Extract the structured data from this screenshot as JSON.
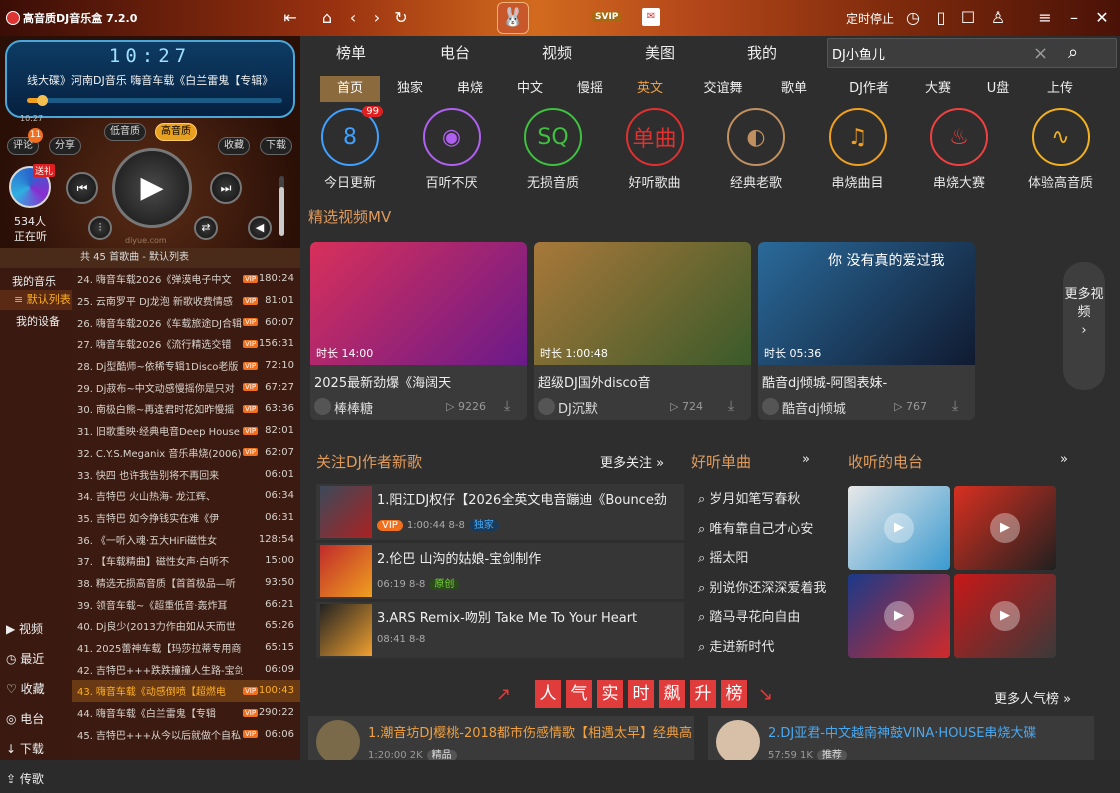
{
  "app": {
    "title": "高音质DJ音乐盒 7.2.0",
    "timer_label": "定时停止",
    "svip": "SVIP"
  },
  "player": {
    "clock": "10:27",
    "scroll_text": "线大碟》河南DJ音乐   嗨音车载《白兰雷鬼【专辑》",
    "elapsed": "10:27",
    "progress": 0.06,
    "volume": 0.82,
    "btn_low": "低音质",
    "btn_high": "高音质",
    "btn_comment": "评论",
    "btn_share": "分享",
    "btn_fav": "收藏",
    "btn_download": "下载",
    "comment_count": "11",
    "gift_tag": "送礼",
    "listeners": "534人",
    "listening": "正在听",
    "watermark": "diyue.com"
  },
  "playlist": {
    "header": "共 45 首歌曲 - 默认列表"
  },
  "nav": {
    "my_music": "我的音乐",
    "default_list": "默认列表",
    "my_device": "我的设备"
  },
  "side": [
    {
      "label": "视频",
      "icon": "video-icon",
      "glyph": "▶"
    },
    {
      "label": "最近",
      "icon": "clock-icon",
      "glyph": "◷"
    },
    {
      "label": "收藏",
      "icon": "heart-icon",
      "glyph": "♡"
    },
    {
      "label": "电台",
      "icon": "radio-icon",
      "glyph": "◎"
    },
    {
      "label": "下载",
      "icon": "download-icon",
      "glyph": "↓"
    },
    {
      "label": "传歌",
      "icon": "upload-icon",
      "glyph": "⇪"
    }
  ],
  "songs": [
    {
      "n": "24.",
      "t": "嗨音车载2026《弹漠电子中文",
      "vip": "VIP",
      "d": "180:24"
    },
    {
      "n": "25.",
      "t": "云南罗平 DJ龙泡 新歌收费情感",
      "vip": "VIP",
      "d": "81:01"
    },
    {
      "n": "26.",
      "t": "嗨音车载2026《车载旅途DJ合辑",
      "vip": "VIP",
      "d": "60:07"
    },
    {
      "n": "27.",
      "t": "嗨音车载2026《流行精选交错",
      "vip": "VIP",
      "d": "156:31"
    },
    {
      "n": "28.",
      "t": "Dj型酷师~依稀专辑1Disco老版",
      "vip": "VIP",
      "d": "72:10"
    },
    {
      "n": "29.",
      "t": "Dj菽布~中文动感慢摇你是只对",
      "vip": "VIP",
      "d": "67:27"
    },
    {
      "n": "30.",
      "t": "南极白熊~再逢君时花如昨慢摇",
      "vip": "VIP",
      "d": "63:36"
    },
    {
      "n": "31.",
      "t": "旧歌重映·经典电音Deep House",
      "vip": "VIP",
      "d": "82:01"
    },
    {
      "n": "32.",
      "t": "C.Y.S.Meganix 音乐串烧(2006)",
      "vip": "VIP",
      "d": "62:07"
    },
    {
      "n": "33.",
      "t": "快四    也许我告别将不再回来",
      "vip": "",
      "d": "06:01"
    },
    {
      "n": "34.",
      "t": "吉特巴    火山热海- 龙江辉、",
      "vip": "",
      "d": "06:34"
    },
    {
      "n": "35.",
      "t": "吉特巴    如今挣钱实在难《伊",
      "vip": "",
      "d": "06:31"
    },
    {
      "n": "36.",
      "t": "《一听入魂·五大HiFi磁性女",
      "vip": "",
      "d": "128:54"
    },
    {
      "n": "37.",
      "t": "【车载精曲】磁性女声·白听不",
      "vip": "",
      "d": "15:00"
    },
    {
      "n": "38.",
      "t": "精选无损高音质【首首极品—听",
      "vip": "",
      "d": "93:50"
    },
    {
      "n": "39.",
      "t": "领音车载~《超重低音·轰炸耳",
      "vip": "",
      "d": "66:21"
    },
    {
      "n": "40.",
      "t": "Dj良少(2013力作由如从天而世",
      "vip": "",
      "d": "65:26"
    },
    {
      "n": "41.",
      "t": "2025蕾神车载【玛莎拉蒂专用商",
      "vip": "",
      "d": "65:15"
    },
    {
      "n": "42.",
      "t": "吉特巴+++跌跌撞撞人生路-宝剑",
      "vip": "",
      "d": "06:09"
    },
    {
      "n": "43.",
      "t": "嗨音车载《动感倒喷【超燃电",
      "vip": "VIP",
      "d": "100:43"
    },
    {
      "n": "44.",
      "t": "嗨音车载《白兰雷鬼【专辑",
      "vip": "VIP",
      "d": "290:22"
    },
    {
      "n": "45.",
      "t": "吉特巴+++从今以后就做个自私",
      "vip": "VIP",
      "d": "06:06"
    }
  ],
  "main": {
    "tabs1": [
      "榜单",
      "电台",
      "视频",
      "美图",
      "我的"
    ],
    "search": {
      "value": "DJ小鱼儿",
      "clear": "×"
    },
    "tabs2": [
      "首页",
      "独家",
      "串烧",
      "中文",
      "慢摇",
      "英文",
      "交谊舞",
      "歌单",
      "DJ作者",
      "大赛",
      "U盘",
      "上传"
    ],
    "categories": [
      {
        "label": "今日更新",
        "glyph": "8",
        "badge": "99",
        "color": "#3fa0ff",
        "icon": "calendar-icon"
      },
      {
        "label": "百听不厌",
        "glyph": "◉",
        "color": "#b060f0",
        "icon": "disc-icon"
      },
      {
        "label": "无损音质",
        "glyph": "SQ",
        "color": "#40c040",
        "icon": "headphones-icon"
      },
      {
        "label": "好听歌曲",
        "glyph": "单曲",
        "color": "#e03030",
        "icon": "single-icon"
      },
      {
        "label": "经典老歌",
        "glyph": "◐",
        "color": "#c09060",
        "icon": "gramophone-icon"
      },
      {
        "label": "串烧曲目",
        "glyph": "♫",
        "color": "#f0a020",
        "icon": "list-music-icon"
      },
      {
        "label": "串烧大赛",
        "glyph": "♨",
        "color": "#f04040",
        "icon": "flame-icon"
      },
      {
        "label": "体验高音质",
        "glyph": "∿",
        "color": "#f0b020",
        "icon": "waveform-icon"
      }
    ],
    "mv_title": "精选视频MV",
    "mv": [
      {
        "title": "2025最新劲爆《海阔天",
        "duration": "时长 14:00",
        "author": "棒棒糖",
        "count": "9226",
        "c1": "#d8305a",
        "c2": "#6a1a8a"
      },
      {
        "title": "超级DJ国外disco音",
        "duration": "时长 1:00:48",
        "author": "DJ沉默",
        "count": "724",
        "c1": "#a8783a",
        "c2": "#3a5a2a"
      },
      {
        "title": "酷音dj倾城-阿图表妹-",
        "duration": "时长 05:36",
        "author": "酷音dj倾城",
        "count": "767",
        "c1": "#2a6a9a",
        "c2": "#101a30",
        "overlay": "你  没有真的爱过我"
      }
    ],
    "more_mv": "更多视频",
    "dj_title": "关注DJ作者新歌",
    "dj_more": "更多关注",
    "dj": [
      {
        "title": "1.阳江DJ权仔【2026全英文电音蹦迪《Bounce劲",
        "meta": "1:00:44  8-8",
        "tag1": "VIP",
        "tag2": "独家",
        "c1": "#3a4a5a",
        "c2": "#aa2222"
      },
      {
        "title": "2.伦巴 山沟的姑娘-宝剑制作",
        "meta": "06:19  8-8",
        "tag1": "",
        "tag2": "原创",
        "c1": "#c02a2a",
        "c2": "#f0a020"
      },
      {
        "title": "3.ARS Remix-吻別 Take Me To Your Heart",
        "meta": "08:41  8-8",
        "tag1": "",
        "tag2": "",
        "c1": "#222222",
        "c2": "#f0a030"
      }
    ],
    "hot_title": "好听单曲",
    "hot": [
      "岁月如笔写春秋",
      "唯有靠自己才心安",
      "摇太阳",
      "别说你还深深爱着我",
      "踏马寻花向自由",
      "走进新时代"
    ],
    "radio_title": "收听的电台",
    "popular_title": [
      "人",
      "气",
      "实",
      "时",
      "飙",
      "升",
      "榜"
    ],
    "popular_more": "更多人气榜",
    "ranks": [
      {
        "title": "1.潮音坊DJ樱桃-2018都市伤感情歌【相遇太早】经典高",
        "meta": "1:20:00  2K",
        "tag": "精品"
      },
      {
        "title": "2.DJ亚君-中文越南神鼓VINA·HOUSE串烧大碟",
        "meta": "57:59  1K",
        "tag": "推荐"
      }
    ]
  }
}
